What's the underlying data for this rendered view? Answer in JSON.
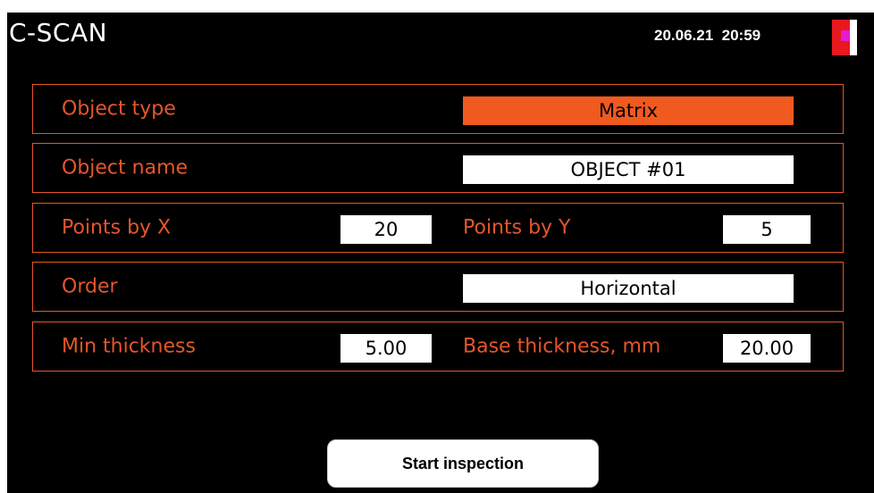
{
  "header": {
    "title": "C-SCAN",
    "date": "20.06.21",
    "time": "20:59"
  },
  "form": {
    "object_type": {
      "label": "Object type",
      "value": "Matrix"
    },
    "object_name": {
      "label": "Object name",
      "value": "OBJECT #01"
    },
    "points_x": {
      "label": "Points by X",
      "value": "20"
    },
    "points_y": {
      "label": "Points by Y",
      "value": "5"
    },
    "order": {
      "label": "Order",
      "value": "Horizontal"
    },
    "min_thickness": {
      "label": "Min thickness",
      "value": "5.00"
    },
    "base_thickness": {
      "label": "Base thickness, mm",
      "value": "20.00"
    }
  },
  "actions": {
    "start_label": "Start inspection"
  },
  "colors": {
    "accent": "#e5562a",
    "accent_fill": "#f05a1f",
    "background": "#000000",
    "status_red": "#e8181e",
    "status_magenta": "#e61bd2"
  },
  "icons": {
    "status": "status-indicator-icon"
  }
}
